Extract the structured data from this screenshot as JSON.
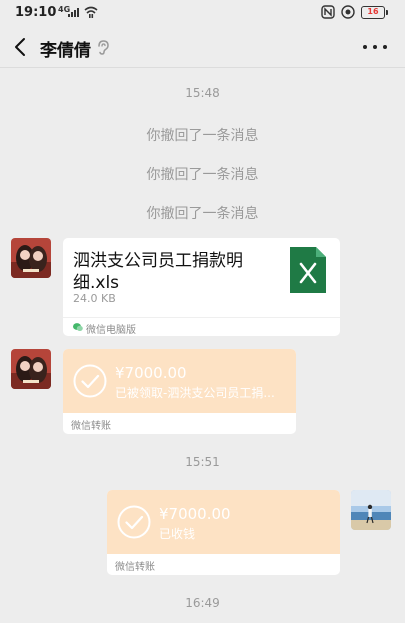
{
  "status_bar": {
    "time": "19:10",
    "signal_label": "4G",
    "battery": "16",
    "icons": [
      "signal-icon",
      "wifi-icon",
      "nfc-icon",
      "vpn-icon",
      "battery-icon"
    ]
  },
  "header": {
    "title": "李倩倩",
    "back_icon": "chevron-left-icon",
    "voice_icon": "ear-icon",
    "more_icon": "more-icon"
  },
  "messages": {
    "time_1": "15:48",
    "recall_1": "你撤回了一条消息",
    "recall_2": "你撤回了一条消息",
    "recall_3": "你撤回了一条消息",
    "file": {
      "name": "泗洪支公司员工捐款明细.xls",
      "size": "24.0 KB",
      "source": "微信电脑版",
      "icon": "excel-file-icon"
    },
    "transfer_received": {
      "amount": "¥7000.00",
      "status": "已被领取-泗洪支公司员工捐...",
      "footer": "微信转账"
    },
    "time_2": "15:51",
    "transfer_sent": {
      "amount": "¥7000.00",
      "status": "已收钱",
      "footer": "微信转账"
    },
    "time_3": "16:49"
  },
  "colors": {
    "background": "#ededed",
    "transfer_accent": "#fde2c4",
    "excel_green": "#1f7a45",
    "battery_low": "#e53935"
  }
}
